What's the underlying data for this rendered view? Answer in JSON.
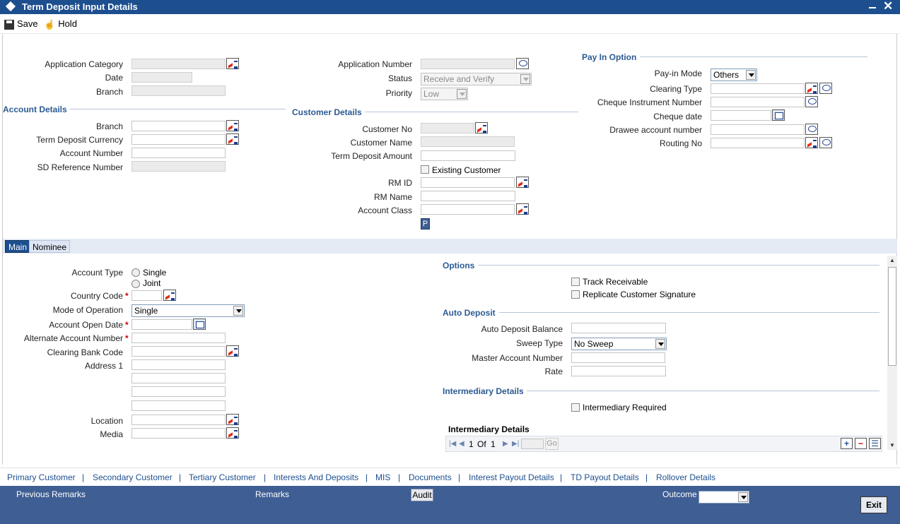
{
  "window": {
    "title": "Term Deposit Input Details"
  },
  "toolbar": {
    "save_label": "Save",
    "hold_label": "Hold"
  },
  "header": {
    "application_category_label": "Application Category",
    "date_label": "Date",
    "branch_label": "Branch",
    "application_number_label": "Application Number",
    "status_label": "Status",
    "status_value": "Receive and Verify",
    "priority_label": "Priority",
    "priority_value": "Low"
  },
  "pay_in": {
    "section_title": "Pay In Option",
    "pay_in_mode_label": "Pay-in Mode",
    "pay_in_mode_value": "Others",
    "clearing_type_label": "Clearing Type",
    "cheque_instrument_label": "Cheque Instrument Number",
    "cheque_date_label": "Cheque date",
    "drawee_account_label": "Drawee account number",
    "routing_no_label": "Routing No"
  },
  "account_details": {
    "section_title": "Account Details",
    "branch_label": "Branch",
    "currency_label": "Term Deposit Currency",
    "account_number_label": "Account Number",
    "sd_reference_label": "SD Reference Number"
  },
  "customer_details": {
    "section_title": "Customer Details",
    "customer_no_label": "Customer No",
    "customer_name_label": "Customer Name",
    "td_amount_label": "Term Deposit Amount",
    "existing_customer_label": "Existing Customer",
    "rm_id_label": "RM ID",
    "rm_name_label": "RM Name",
    "account_class_label": "Account Class",
    "p_button": "P"
  },
  "tabs": {
    "main": "Main",
    "nominee": "Nominee"
  },
  "main": {
    "account_type_label": "Account Type",
    "single_label": "Single",
    "joint_label": "Joint",
    "country_code_label": "Country Code",
    "mode_of_operation_label": "Mode of Operation",
    "mode_of_operation_value": "Single",
    "account_open_date_label": "Account Open Date",
    "alt_account_label": "Alternate Account Number",
    "clearing_bank_label": "Clearing Bank Code",
    "address1_label": "Address 1",
    "location_label": "Location",
    "media_label": "Media",
    "required_marker": "*"
  },
  "options": {
    "section_title": "Options",
    "track_receivable_label": "Track Receivable",
    "replicate_sig_label": "Replicate Customer Signature"
  },
  "auto_deposit": {
    "section_title": "Auto Deposit",
    "balance_label": "Auto Deposit Balance",
    "sweep_type_label": "Sweep Type",
    "sweep_type_value": "No Sweep",
    "master_account_label": "Master Account Number",
    "rate_label": "Rate"
  },
  "intermediary": {
    "section_title": "Intermediary Details",
    "required_label": "Intermediary Required",
    "grid_title": "Intermediary Details",
    "page_current": "1",
    "page_of": "Of",
    "page_total": "1",
    "go_label": "Go"
  },
  "footer_links": [
    "Primary Customer",
    "Secondary Customer",
    "Tertiary Customer",
    "Interests And Deposits",
    "MIS",
    "Documents",
    "Interest Payout Details",
    "TD Payout Details",
    "Rollover Details"
  ],
  "footer_sep": "|",
  "footer": {
    "previous_remarks": "Previous Remarks",
    "remarks": "Remarks",
    "audit": "Audit",
    "outcome": "Outcome",
    "exit": "Exit"
  }
}
